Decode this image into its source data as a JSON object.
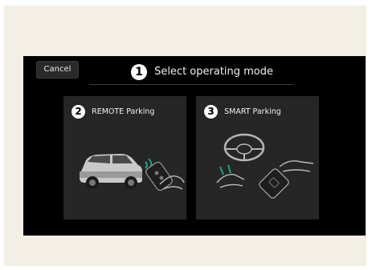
{
  "dialog": {
    "cancel_label": "Cancel",
    "title_step": "1",
    "title": "Select operating mode"
  },
  "options": [
    {
      "step": "2",
      "label": "REMOTE Parking",
      "icon": "remote-parking-car-key-icon"
    },
    {
      "step": "3",
      "label": "SMART Parking",
      "icon": "smart-parking-wheel-key-icon"
    }
  ],
  "colors": {
    "background": "#f4efe4",
    "screen": "#000000",
    "card": "#262626",
    "accent": "#1aa58a"
  }
}
